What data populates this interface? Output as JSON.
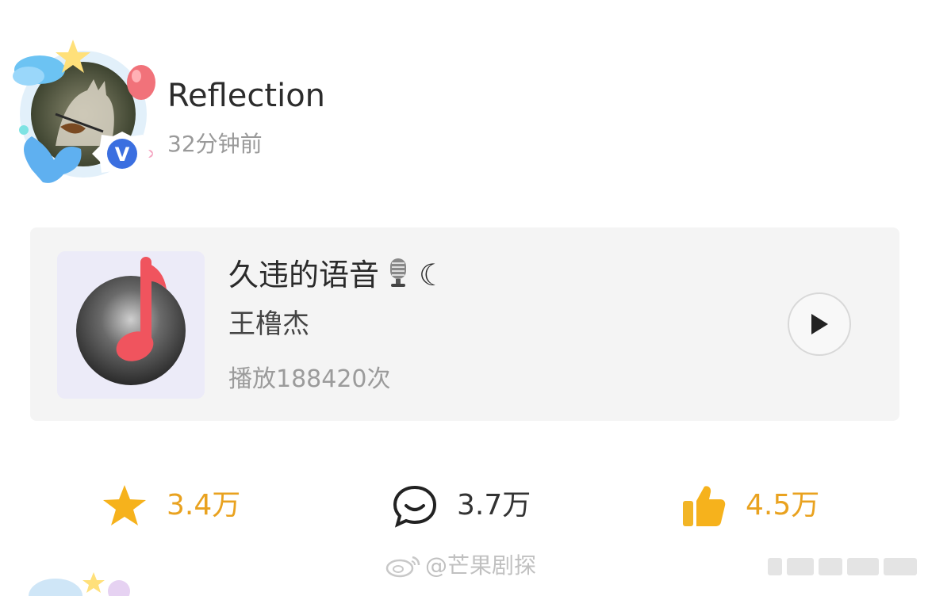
{
  "post": {
    "username": "Reflection",
    "timestamp": "32分钟前",
    "verified_badge": "V"
  },
  "music_card": {
    "title": "久违的语音",
    "title_emojis": [
      "microphone-icon",
      "crescent-moon"
    ],
    "moon_glyph": "☾",
    "artist": "王橹杰",
    "plays": "播放188420次",
    "play_icon": "play-icon"
  },
  "actions": {
    "favorites": "3.4万",
    "comments": "3.7万",
    "likes": "4.5万"
  },
  "watermark": {
    "text": "@芒果剧探"
  },
  "colors": {
    "accent": "#e9a21f",
    "card_bg": "#f4f4f4",
    "note_red": "#f0545e",
    "verified_blue": "#3b6fe0"
  }
}
